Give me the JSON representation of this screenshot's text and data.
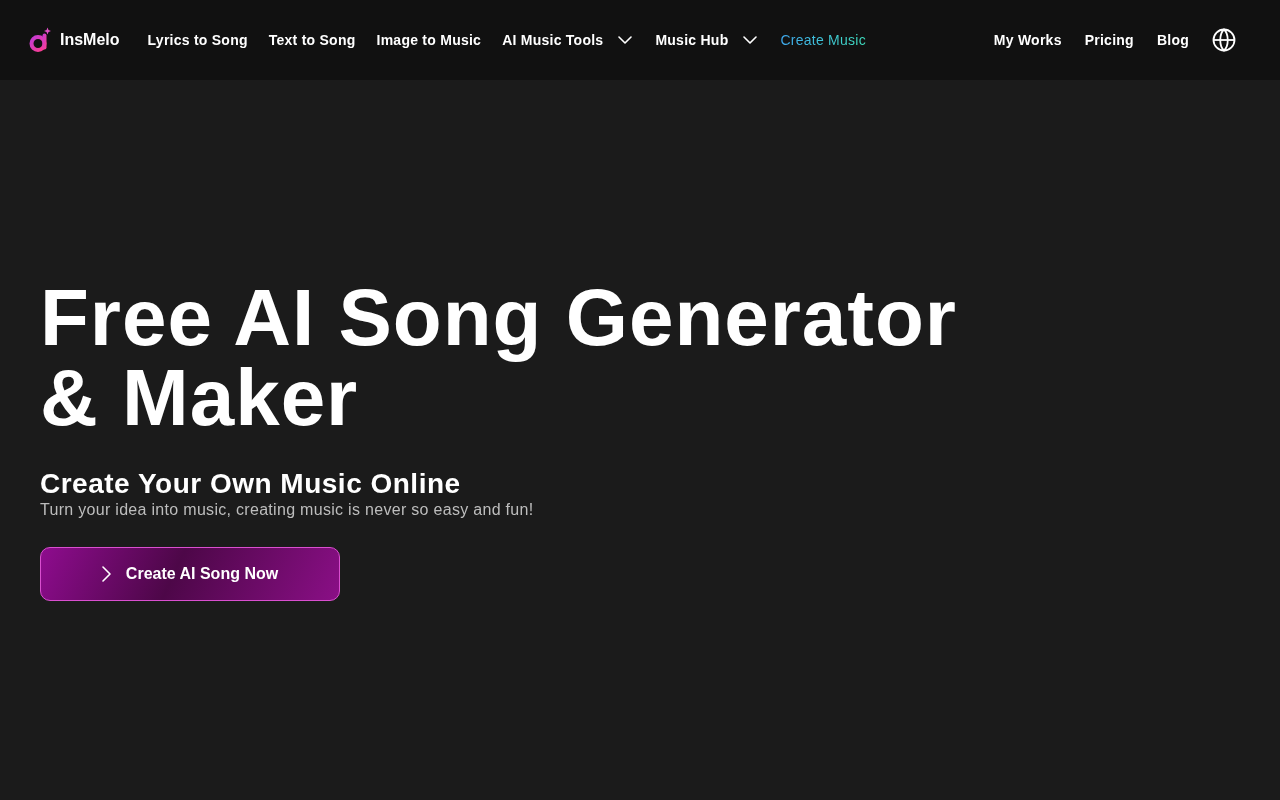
{
  "header": {
    "logo": {
      "name": "InsMelo"
    },
    "nav": [
      {
        "label": "Lyrics to Song",
        "kind": "link"
      },
      {
        "label": "Text to Song",
        "kind": "link"
      },
      {
        "label": "Image to Music",
        "kind": "link"
      },
      {
        "label": "AI Music Tools",
        "kind": "dropdown"
      },
      {
        "label": "Music Hub",
        "kind": "dropdown"
      },
      {
        "label": "Create Music",
        "kind": "accent"
      }
    ],
    "right_nav": [
      {
        "label": "My Works",
        "kind": "link"
      },
      {
        "label": "Pricing",
        "kind": "link"
      },
      {
        "label": "Blog",
        "kind": "link"
      }
    ]
  },
  "hero": {
    "title": "Free AI Song Generator & Maker",
    "heading": "Create Your Own Music Online",
    "tagline": "Turn your idea into music, creating music is never so easy and fun!",
    "cta": {
      "label": "Create AI Song Now"
    }
  }
}
